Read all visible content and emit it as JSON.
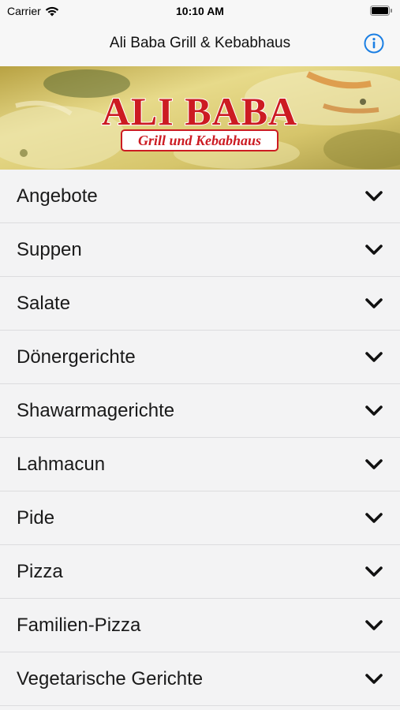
{
  "status_bar": {
    "carrier": "Carrier",
    "time": "10:10 AM"
  },
  "nav": {
    "title": "Ali Baba Grill & Kebabhaus",
    "info_icon": "info-icon",
    "accent_color": "#1b7fe3"
  },
  "banner": {
    "logo_title": "ALI BABA",
    "logo_subtitle": "Grill und Kebabhaus",
    "logo_color": "#cc1b22"
  },
  "menu": {
    "items": [
      {
        "label": "Angebote"
      },
      {
        "label": "Suppen"
      },
      {
        "label": "Salate"
      },
      {
        "label": "Dönergerichte"
      },
      {
        "label": "Shawarmagerichte"
      },
      {
        "label": "Lahmacun"
      },
      {
        "label": "Pide"
      },
      {
        "label": "Pizza"
      },
      {
        "label": "Familien-Pizza"
      },
      {
        "label": "Vegetarische Gerichte"
      }
    ],
    "expand_icon": "chevron-down-icon"
  }
}
